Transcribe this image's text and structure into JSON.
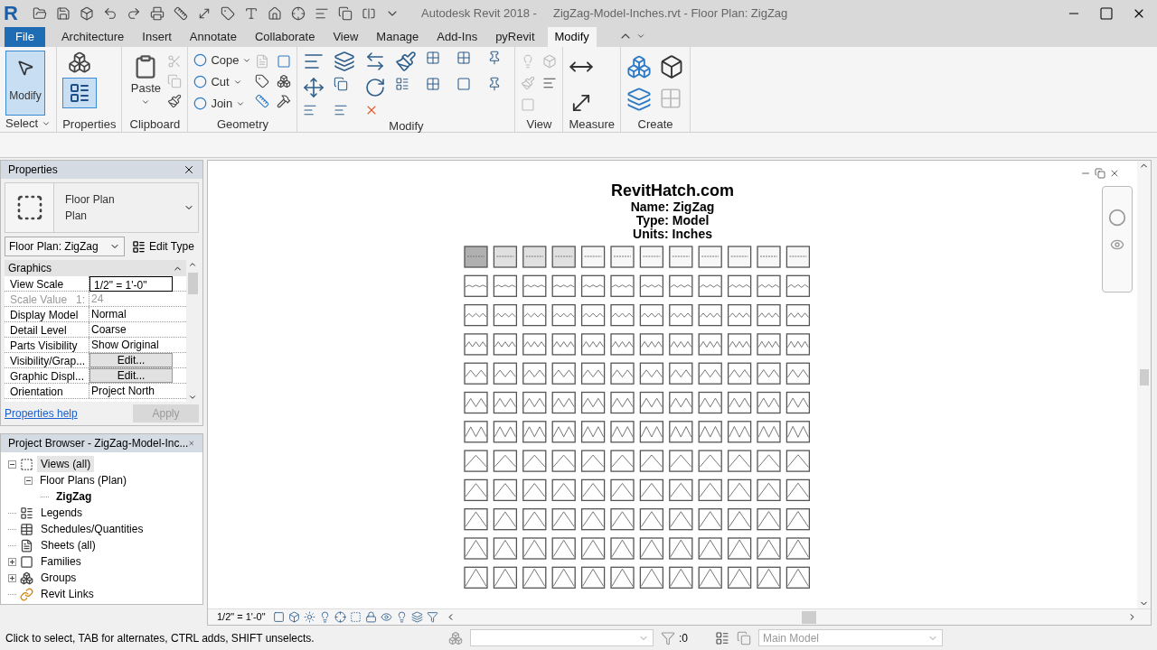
{
  "title_bar": {
    "logo": "R",
    "title": "Autodesk Revit 2018 -     ZigZag-Model-Inches.rvt - Floor Plan: ZigZag"
  },
  "ribbon_tabs": [
    {
      "label": "File",
      "kind": "file",
      "selected": false
    },
    {
      "label": "Architecture",
      "kind": "tab",
      "selected": false
    },
    {
      "label": "Insert",
      "kind": "tab",
      "selected": false
    },
    {
      "label": "Annotate",
      "kind": "tab",
      "selected": false
    },
    {
      "label": "Collaborate",
      "kind": "tab",
      "selected": false
    },
    {
      "label": "View",
      "kind": "tab",
      "selected": false
    },
    {
      "label": "Manage",
      "kind": "tab",
      "selected": false
    },
    {
      "label": "Add-Ins",
      "kind": "tab",
      "selected": false
    },
    {
      "label": "pyRevit",
      "kind": "tab",
      "selected": false
    },
    {
      "label": "Modify",
      "kind": "tab",
      "selected": true
    }
  ],
  "ribbon": {
    "select_panel": {
      "button": "Modify",
      "selected": true,
      "label": "Select"
    },
    "properties_panel": {
      "label": "Properties",
      "selected": true
    },
    "clipboard_panel": {
      "paste": "Paste",
      "label": "Clipboard"
    },
    "geometry_panel": {
      "tools": [
        "Cope",
        "Cut",
        "Join"
      ],
      "label": "Geometry"
    },
    "modify_panel": {
      "label": "Modify"
    },
    "view_panel": {
      "label": "View"
    },
    "measure_panel": {
      "label": "Measure"
    },
    "create_panel": {
      "label": "Create"
    }
  },
  "properties": {
    "title": "Properties",
    "type_lines": [
      "Floor Plan",
      "Plan"
    ],
    "instance": "Floor Plan: ZigZag",
    "edit_type": "Edit Type",
    "group": "Graphics",
    "rows": [
      {
        "label": "View Scale",
        "value": "1/2\" = 1'-0\"",
        "kind": "input"
      },
      {
        "label": "Scale Value",
        "unit": "1:",
        "value": "24",
        "kind": "readonly"
      },
      {
        "label": "Display Model",
        "value": "Normal",
        "kind": "text"
      },
      {
        "label": "Detail Level",
        "value": "Coarse",
        "kind": "text"
      },
      {
        "label": "Parts Visibility",
        "value": "Show Original",
        "kind": "text"
      },
      {
        "label": "Visibility/Grap...",
        "value": "Edit...",
        "kind": "button"
      },
      {
        "label": "Graphic Displ...",
        "value": "Edit...",
        "kind": "button"
      },
      {
        "label": "Orientation",
        "value": "Project North",
        "kind": "text"
      }
    ],
    "help": "Properties help",
    "apply": {
      "label": "Apply",
      "disabled": true
    }
  },
  "project_browser": {
    "title": "Project Browser - ZigZag-Model-Inc...",
    "tree": [
      {
        "label": "Views (all)",
        "expanded": true,
        "selected": true,
        "current": false,
        "children": [
          {
            "label": "Floor Plans (Plan)",
            "expanded": true,
            "selected": false,
            "current": false,
            "children": [
              {
                "label": "ZigZag",
                "selected": false,
                "current": true
              }
            ]
          }
        ]
      },
      {
        "label": "Legends",
        "selected": false,
        "current": false
      },
      {
        "label": "Schedules/Quantities",
        "selected": false,
        "current": false
      },
      {
        "label": "Sheets (all)",
        "selected": false,
        "current": false
      },
      {
        "label": "Families",
        "expanded": false,
        "selected": false,
        "current": false
      },
      {
        "label": "Groups",
        "expanded": false,
        "selected": false,
        "current": false
      },
      {
        "label": "Revit Links",
        "selected": false,
        "current": false
      }
    ]
  },
  "view": {
    "heading": "RevitHatch.com",
    "lines": [
      "Name: ZigZag",
      "Type: Model",
      "Units: Inches"
    ],
    "scale": "1/2\" = 1'-0\""
  },
  "status_bar": {
    "message": "Click to select, TAB for alternates, CTRL adds, SHIFT unselects.",
    "filter_count": ":0",
    "workset": "Main Model"
  }
}
